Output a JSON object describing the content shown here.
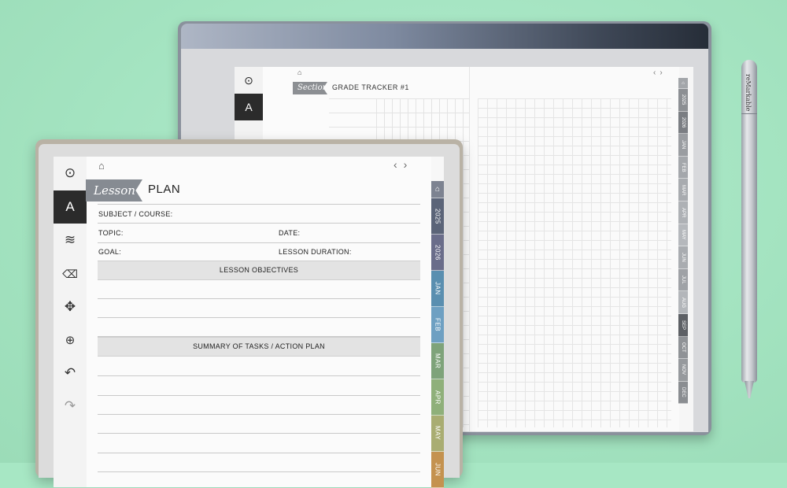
{
  "back_device": {
    "section_label": "Section",
    "section_title": "GRADE TRACKER #1",
    "home_icon": "home-icon",
    "nav_prev": "‹",
    "nav_next": "›",
    "tabs": [
      "2025",
      "2026",
      "JAN",
      "FEB",
      "MAR",
      "APR",
      "MAY",
      "JUN",
      "JUL",
      "AUG",
      "SEP",
      "OCT",
      "NOV",
      "DEC"
    ],
    "tab_colors": [
      "#8c8f93",
      "#7b7e83",
      "#9a9da1",
      "#a4a7ab",
      "#a8abaf",
      "#aeb1b5",
      "#b5b8bc",
      "#a9acb0",
      "#9fa2a6",
      "#b3b6ba",
      "#5d6065",
      "#8f9296",
      "#96999d",
      "#8a8d91"
    ]
  },
  "pen": {
    "brand": "reMarkable"
  },
  "front_device": {
    "title_script": "Lesson",
    "title": "PLAN",
    "home_icon": "home-icon",
    "nav_prev": "‹",
    "nav_next": "›",
    "fields": {
      "subject": "SUBJECT / COURSE:",
      "topic": "TOPIC:",
      "date": "DATE:",
      "goal": "GOAL:",
      "duration": "LESSON DURATION:"
    },
    "sections": {
      "objectives": "LESSON OBJECTIVES",
      "summary": "SUMMARY OF TASKS / ACTION PLAN"
    },
    "tools": [
      "pen-circle-icon",
      "pen-tool-icon",
      "text-lines-icon",
      "eraser-icon",
      "move-icon",
      "zoom-icon",
      "undo-icon",
      "redo-icon"
    ],
    "tabs": [
      "2025",
      "2026",
      "JAN",
      "FEB",
      "MAR",
      "APR",
      "MAY",
      "JUN"
    ],
    "tab_colors": [
      "#5b6478",
      "#6a6d8a",
      "#5a8fb0",
      "#6ea0c2",
      "#7ea37a",
      "#8fb07a",
      "#a9ad72",
      "#c4924f"
    ]
  }
}
